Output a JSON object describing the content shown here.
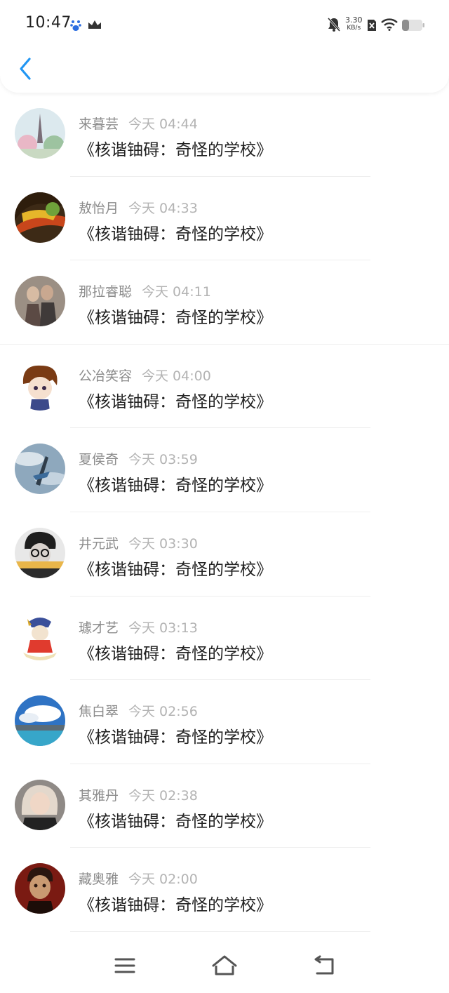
{
  "status_bar": {
    "time": "10:47",
    "net_speed_value": "3.30",
    "net_speed_unit": "KB/s",
    "icons": [
      "baidu-paw-icon",
      "crown-icon",
      "bell-muted-icon",
      "sim-x-icon",
      "wifi-icon",
      "battery-icon"
    ]
  },
  "header": {
    "back_icon": "chevron-left-icon"
  },
  "colors": {
    "accent": "#2196f3",
    "name": "#8c8c8c",
    "time": "#b3b3b3",
    "title": "#222222"
  },
  "items": [
    {
      "author": "来暮芸",
      "time": "今天 04:44",
      "title": "《核谐铀碍：奇怪的学校》"
    },
    {
      "author": "敖怡月",
      "time": "今天 04:33",
      "title": "《核谐铀碍：奇怪的学校》"
    },
    {
      "author": "那拉睿聪",
      "time": "今天 04:11",
      "title": "《核谐铀碍：奇怪的学校》"
    },
    {
      "author": "公冶笑容",
      "time": "今天 04:00",
      "title": "《核谐铀碍：奇怪的学校》"
    },
    {
      "author": "夏侯奇",
      "time": "今天 03:59",
      "title": "《核谐铀碍：奇怪的学校》"
    },
    {
      "author": "井元武",
      "time": "今天 03:30",
      "title": "《核谐铀碍：奇怪的学校》"
    },
    {
      "author": "璩才艺",
      "time": "今天 03:13",
      "title": "《核谐铀碍：奇怪的学校》"
    },
    {
      "author": "焦白翠",
      "time": "今天 02:56",
      "title": "《核谐铀碍：奇怪的学校》"
    },
    {
      "author": "其雅丹",
      "time": "今天 02:38",
      "title": "《核谐铀碍：奇怪的学校》"
    },
    {
      "author": "藏奥雅",
      "time": "今天 02:00",
      "title": "《核谐铀碍：奇怪的学校》"
    }
  ],
  "nav_bar": {
    "icons": [
      "menu-icon",
      "home-icon",
      "back-icon"
    ]
  }
}
